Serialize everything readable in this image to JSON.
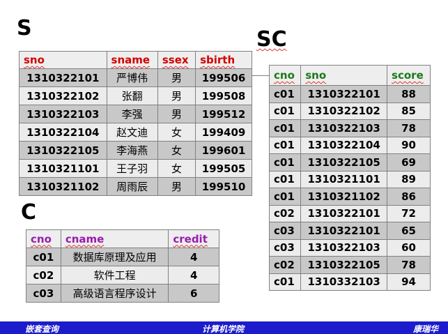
{
  "labels": {
    "s": "S",
    "sc": "SC",
    "c": "C"
  },
  "table_s": {
    "headers": [
      "sno",
      "sname",
      "ssex",
      "sbirth"
    ],
    "rows": [
      [
        "1310322101",
        "严博伟",
        "男",
        "199506"
      ],
      [
        "1310322102",
        "张翻",
        "男",
        "199508"
      ],
      [
        "1310322103",
        "李强",
        "男",
        "199512"
      ],
      [
        "1310322104",
        "赵文迪",
        "女",
        "199409"
      ],
      [
        "1310322105",
        "李海燕",
        "女",
        "199601"
      ],
      [
        "1310321101",
        "王子羽",
        "女",
        "199505"
      ],
      [
        "1310321102",
        "周雨辰",
        "男",
        "199510"
      ]
    ]
  },
  "table_sc": {
    "headers": [
      "cno",
      "sno",
      "score"
    ],
    "rows": [
      [
        "c01",
        "1310322101",
        "88"
      ],
      [
        "c01",
        "1310322102",
        "85"
      ],
      [
        "c01",
        "1310322103",
        "78"
      ],
      [
        "c01",
        "1310322104",
        "90"
      ],
      [
        "c01",
        "1310322105",
        "69"
      ],
      [
        "c01",
        "1310321101",
        "89"
      ],
      [
        "c01",
        "1310321102",
        "86"
      ],
      [
        "c02",
        "1310322101",
        "72"
      ],
      [
        "c03",
        "1310322101",
        "65"
      ],
      [
        "c03",
        "1310322103",
        "60"
      ],
      [
        "c02",
        "1310322105",
        "78"
      ],
      [
        "c01",
        "1310332103",
        "94"
      ]
    ]
  },
  "table_c": {
    "headers": [
      "cno",
      "cname",
      "credit"
    ],
    "rows": [
      [
        "c01",
        "数据库原理及应用",
        "4"
      ],
      [
        "c02",
        "软件工程",
        "4"
      ],
      [
        "c03",
        "高级语言程序设计",
        "6"
      ]
    ]
  },
  "footer": {
    "left": "嵌套查询",
    "center": "计算机学院",
    "right": "康瑞华"
  },
  "colors": {
    "s_header": "#d40000",
    "sc_header": "#1a7a1a",
    "c_header": "#9a1ab0",
    "footer_bg": "#1c1ccc"
  }
}
